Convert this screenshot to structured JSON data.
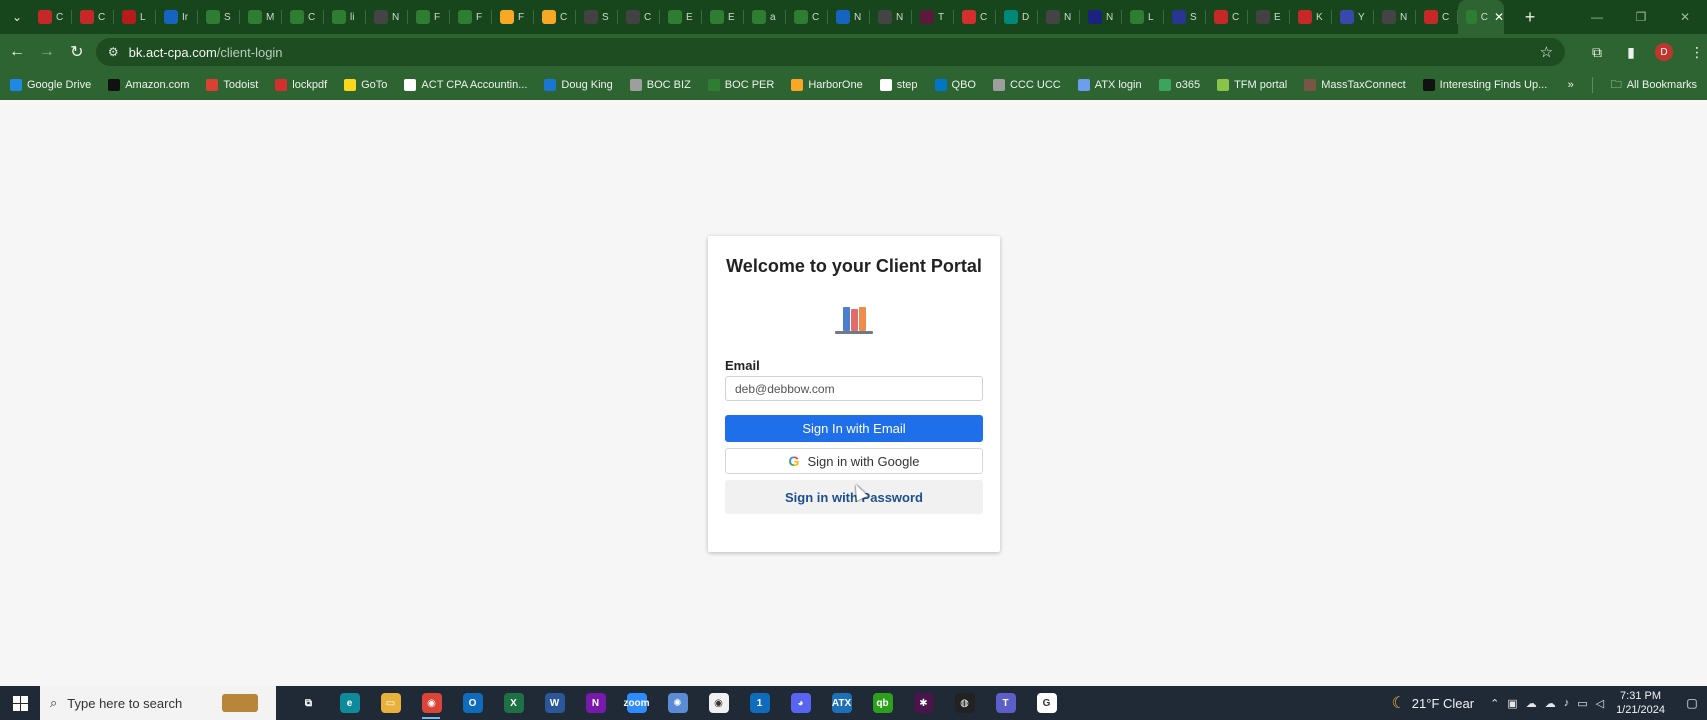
{
  "browser": {
    "tabs": [
      {
        "icon": "pdf-icon",
        "color": "#c62828",
        "letter": "C"
      },
      {
        "icon": "pdf-icon",
        "color": "#c62828",
        "letter": "C"
      },
      {
        "icon": "red-circle-icon",
        "color": "#b71c1c",
        "letter": "L"
      },
      {
        "icon": "blue-circle-icon",
        "color": "#1565c0",
        "letter": "Ir"
      },
      {
        "icon": "gear-icon",
        "color": "#2e7d32",
        "letter": "S"
      },
      {
        "icon": "globe-icon",
        "color": "#2e7d32",
        "letter": "M"
      },
      {
        "icon": "globe-icon",
        "color": "#2e7d32",
        "letter": "C"
      },
      {
        "icon": "globe-icon",
        "color": "#2e7d32",
        "letter": "li"
      },
      {
        "icon": "chrome-icon",
        "color": "#444444",
        "letter": "N"
      },
      {
        "icon": "circle-icon",
        "color": "#2e7d32",
        "letter": "F"
      },
      {
        "icon": "globe-icon",
        "color": "#2e7d32",
        "letter": "F"
      },
      {
        "icon": "warning-icon",
        "color": "#f9a825",
        "letter": "F"
      },
      {
        "icon": "warning-icon",
        "color": "#f9a825",
        "letter": "C"
      },
      {
        "icon": "gear-icon",
        "color": "#424242",
        "letter": "S"
      },
      {
        "icon": "link-icon",
        "color": "#424242",
        "letter": "C"
      },
      {
        "icon": "globe-icon",
        "color": "#2e7d32",
        "letter": "E"
      },
      {
        "icon": "globe-icon",
        "color": "#2e7d32",
        "letter": "E"
      },
      {
        "icon": "globe-icon",
        "color": "#2e7d32",
        "letter": "a"
      },
      {
        "icon": "globe-icon",
        "color": "#2e7d32",
        "letter": "C"
      },
      {
        "icon": "circle-icon",
        "color": "#1565c0",
        "letter": "N"
      },
      {
        "icon": "chrome-icon",
        "color": "#444444",
        "letter": "N"
      },
      {
        "icon": "circle-icon",
        "color": "#5c1a3a",
        "letter": "T"
      },
      {
        "icon": "mail-icon",
        "color": "#d32f2f",
        "letter": "C"
      },
      {
        "icon": "circle-icon",
        "color": "#00897b",
        "letter": "D"
      },
      {
        "icon": "chrome-icon",
        "color": "#444444",
        "letter": "N"
      },
      {
        "icon": "circle-icon",
        "color": "#1a237e",
        "letter": "N"
      },
      {
        "icon": "circle-icon",
        "color": "#2e7d32",
        "letter": "L"
      },
      {
        "icon": "circle-icon",
        "color": "#283593",
        "letter": "S"
      },
      {
        "icon": "pen-icon",
        "color": "#c62828",
        "letter": "C"
      },
      {
        "icon": "globe-icon",
        "color": "#424242",
        "letter": "E"
      },
      {
        "icon": "pdf-icon",
        "color": "#c62828",
        "letter": "K"
      },
      {
        "icon": "k-icon",
        "color": "#3949ab",
        "letter": "Y"
      },
      {
        "icon": "chrome-icon",
        "color": "#444444",
        "letter": "N"
      },
      {
        "icon": "pdf-icon",
        "color": "#c62828",
        "letter": "C"
      }
    ],
    "active_tab": {
      "icon": "globe-icon",
      "color": "#2e7d32",
      "letter": "C"
    },
    "url_host": "bk.act-cpa.com",
    "url_path": "/client-login",
    "profile_initial": "D",
    "bookmarks": [
      {
        "label": "Google Drive",
        "icon": "google-drive-icon",
        "color": "#1e88e5"
      },
      {
        "label": "Amazon.com",
        "icon": "amazon-icon",
        "color": "#111111"
      },
      {
        "label": "Todoist",
        "icon": "todoist-icon",
        "color": "#db4035"
      },
      {
        "label": "lockpdf",
        "icon": "pdf-icon",
        "color": "#d32f2f"
      },
      {
        "label": "GoTo",
        "icon": "goto-icon",
        "color": "#f9d71c"
      },
      {
        "label": "ACT CPA Accountin...",
        "icon": "document-icon",
        "color": "#ffffff"
      },
      {
        "label": "Doug King",
        "icon": "edge-icon",
        "color": "#1976d2"
      },
      {
        "label": "BOC BIZ",
        "icon": "globe-icon",
        "color": "#9e9e9e"
      },
      {
        "label": "BOC PER",
        "icon": "diamond-icon",
        "color": "#2e7d32"
      },
      {
        "label": "HarborOne",
        "icon": "harbor-icon",
        "color": "#f9a825"
      },
      {
        "label": "step",
        "icon": "chart-icon",
        "color": "#ffffff"
      },
      {
        "label": "QBO",
        "icon": "qbo-icon",
        "color": "#0077c5"
      },
      {
        "label": "CCC UCC",
        "icon": "wordpress-icon",
        "color": "#9e9e9e"
      },
      {
        "label": "ATX login",
        "icon": "atx-icon",
        "color": "#6d9eeb"
      },
      {
        "label": "o365",
        "icon": "o365-icon",
        "color": "#3ba55d"
      },
      {
        "label": "TFM portal",
        "icon": "leaf-icon",
        "color": "#8bc34a"
      },
      {
        "label": "MassTaxConnect",
        "icon": "seal-icon",
        "color": "#795548"
      },
      {
        "label": "Interesting Finds Up...",
        "icon": "amazon-icon",
        "color": "#111111"
      }
    ],
    "all_bookmarks_label": "All Bookmarks"
  },
  "portal": {
    "title": "Welcome to your Client Portal",
    "email_label": "Email",
    "email_value": "deb@debbow.com",
    "sign_in_email": "Sign In with Email",
    "sign_in_google": "Sign in with Google",
    "sign_in_password": "Sign in with Password",
    "colors": {
      "primary": "#1f6feb",
      "password_text": "#1c4f8e"
    }
  },
  "taskbar": {
    "search_placeholder": "Type here to search",
    "apps": [
      {
        "name": "task-view",
        "label": "⧉",
        "color": "#1f2a36"
      },
      {
        "name": "edge",
        "label": "e",
        "color": "#0f8a9b"
      },
      {
        "name": "file-explorer",
        "label": "▭",
        "color": "#e8b13b"
      },
      {
        "name": "chrome",
        "label": "◉",
        "color": "#db4437",
        "active": true
      },
      {
        "name": "outlook",
        "label": "O",
        "color": "#0f6cbd"
      },
      {
        "name": "excel",
        "label": "X",
        "color": "#1e7145"
      },
      {
        "name": "word",
        "label": "W",
        "color": "#2b579a"
      },
      {
        "name": "onenote",
        "label": "N",
        "color": "#7719aa"
      },
      {
        "name": "zoom",
        "label": "zoom",
        "color": "#2d8cff"
      },
      {
        "name": "settings-app",
        "label": "✺",
        "color": "#5b8bd4"
      },
      {
        "name": "chrome-2",
        "label": "◉",
        "color": "#f1f1f1"
      },
      {
        "name": "calendar",
        "label": "1",
        "color": "#0f6cbd"
      },
      {
        "name": "discord",
        "label": "◕",
        "color": "#5865f2"
      },
      {
        "name": "atx",
        "label": "ATX",
        "color": "#1d6fb8"
      },
      {
        "name": "quickbooks",
        "label": "qb",
        "color": "#2ca01c"
      },
      {
        "name": "slack",
        "label": "✱",
        "color": "#4a154b"
      },
      {
        "name": "app-dark",
        "label": "◍",
        "color": "#222222"
      },
      {
        "name": "teams",
        "label": "T",
        "color": "#5b5fc7"
      },
      {
        "name": "google-app",
        "label": "G",
        "color": "#ffffff"
      }
    ],
    "weather": "21°F  Clear",
    "time": "7:31 PM",
    "date": "1/21/2024"
  }
}
